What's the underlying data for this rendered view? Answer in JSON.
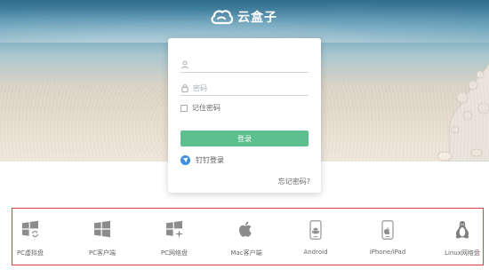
{
  "brand": {
    "name": "云盒子"
  },
  "login": {
    "username_placeholder": "",
    "password_placeholder": "密码",
    "remember_label": "记住密码",
    "login_button": "登录",
    "dingtalk_label": "钉钉登录",
    "forgot_label": "忘记密码?"
  },
  "downloads": [
    {
      "label": "PC虚拟盘",
      "icon": "windows-sync-icon"
    },
    {
      "label": "PC客户端",
      "icon": "windows-icon"
    },
    {
      "label": "PC网络盘",
      "icon": "windows-network-icon"
    },
    {
      "label": "Mac客户端",
      "icon": "apple-icon"
    },
    {
      "label": "Android",
      "icon": "android-phone-icon"
    },
    {
      "label": "iPhone/iPad",
      "icon": "iphone-icon"
    },
    {
      "label": "Linux网络盘",
      "icon": "linux-penguin-icon"
    }
  ],
  "colors": {
    "login_button": "#5bbf8f",
    "highlight_border": "#e53a3a",
    "icon_gray": "#8c8c8c"
  }
}
